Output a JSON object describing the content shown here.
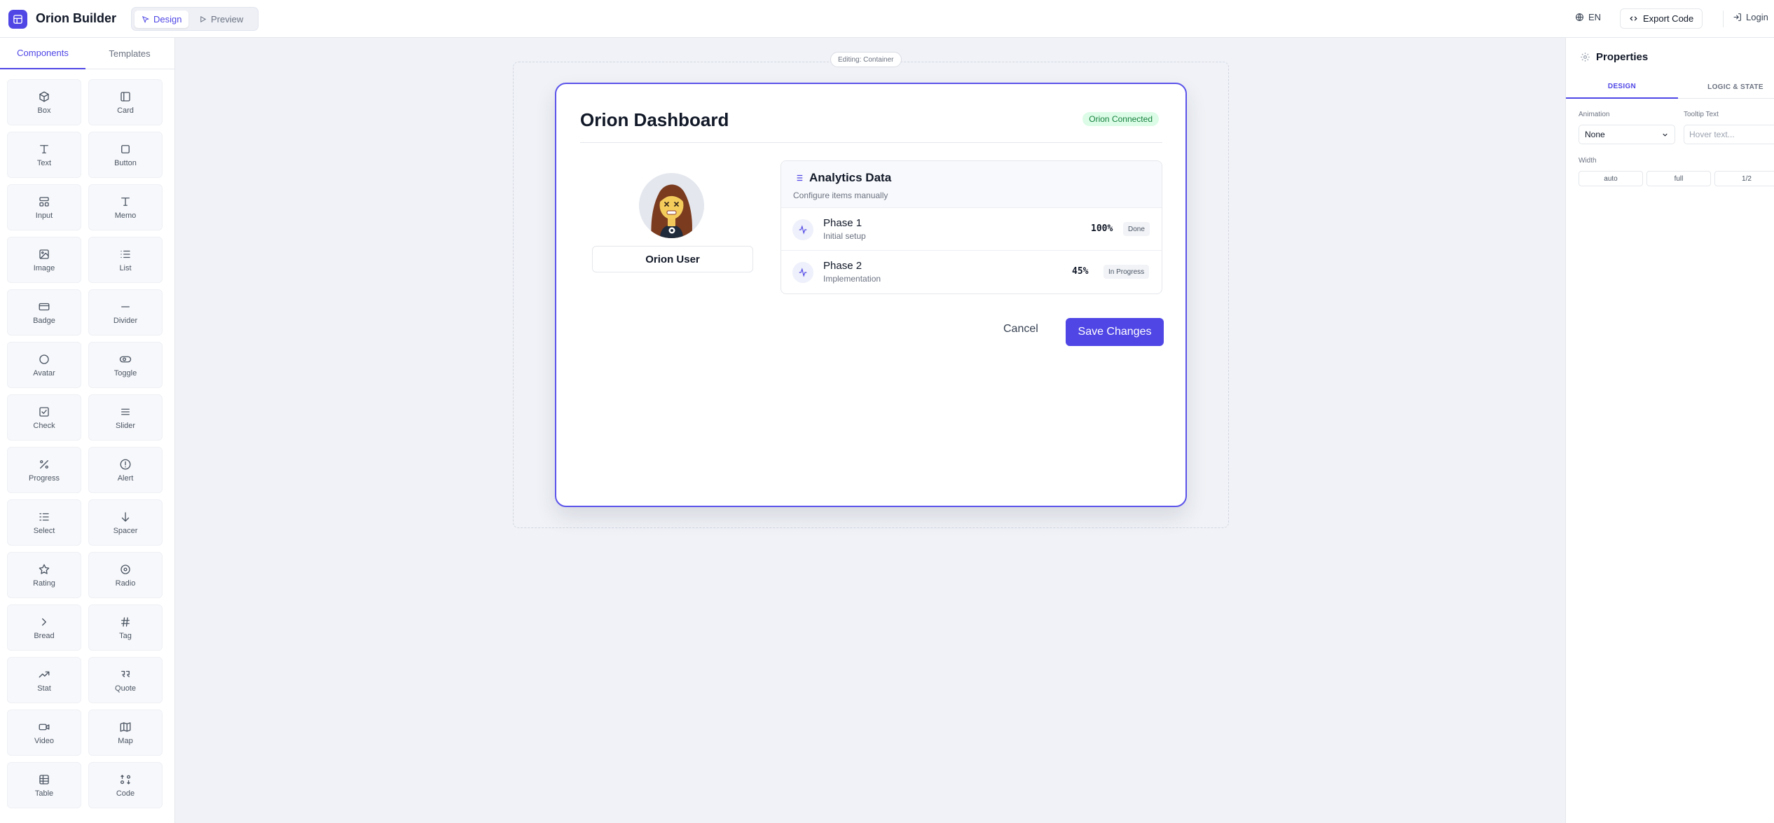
{
  "app": {
    "title": "Orion Builder"
  },
  "header": {
    "modes": [
      {
        "label": "Design"
      },
      {
        "label": "Preview"
      }
    ],
    "language": "EN",
    "export_label": "Export Code",
    "login_label": "Login"
  },
  "sidebar": {
    "tabs": [
      {
        "label": "Components"
      },
      {
        "label": "Templates"
      }
    ],
    "components": [
      {
        "label": "Box",
        "icon": "box-icon"
      },
      {
        "label": "Card",
        "icon": "card-icon"
      },
      {
        "label": "Text",
        "icon": "text-icon"
      },
      {
        "label": "Button",
        "icon": "button-icon"
      },
      {
        "label": "Input",
        "icon": "input-icon"
      },
      {
        "label": "Memo",
        "icon": "memo-icon"
      },
      {
        "label": "Image",
        "icon": "image-icon"
      },
      {
        "label": "List",
        "icon": "list-icon"
      },
      {
        "label": "Badge",
        "icon": "badge-icon"
      },
      {
        "label": "Divider",
        "icon": "divider-icon"
      },
      {
        "label": "Avatar",
        "icon": "avatar-icon"
      },
      {
        "label": "Toggle",
        "icon": "toggle-icon"
      },
      {
        "label": "Check",
        "icon": "check-icon"
      },
      {
        "label": "Slider",
        "icon": "slider-icon"
      },
      {
        "label": "Progress",
        "icon": "percent-icon"
      },
      {
        "label": "Alert",
        "icon": "alert-icon"
      },
      {
        "label": "Select",
        "icon": "select-icon"
      },
      {
        "label": "Spacer",
        "icon": "arrow-down-icon"
      },
      {
        "label": "Rating",
        "icon": "star-icon"
      },
      {
        "label": "Radio",
        "icon": "radio-icon"
      },
      {
        "label": "Bread",
        "icon": "chevron-right-icon"
      },
      {
        "label": "Tag",
        "icon": "hash-icon"
      },
      {
        "label": "Stat",
        "icon": "trending-up-icon"
      },
      {
        "label": "Quote",
        "icon": "quote-icon"
      },
      {
        "label": "Video",
        "icon": "video-icon"
      },
      {
        "label": "Map",
        "icon": "map-icon"
      },
      {
        "label": "Table",
        "icon": "table-icon"
      },
      {
        "label": "Code",
        "icon": "code-icon"
      }
    ]
  },
  "canvas": {
    "editing_label": "Editing: Container",
    "card": {
      "title": "Orion Dashboard",
      "badge": "Orion Connected",
      "user_name": "Orion User",
      "analytics": {
        "title": "Analytics Data",
        "subtitle": "Configure items manually",
        "phases": [
          {
            "name": "Phase 1",
            "desc": "Initial setup",
            "progress": "100%",
            "status": "Done"
          },
          {
            "name": "Phase 2",
            "desc": "Implementation",
            "progress": "45%",
            "status": "In Progress"
          }
        ]
      },
      "cancel_label": "Cancel",
      "save_label": "Save Changes"
    }
  },
  "properties": {
    "title": "Properties",
    "tabs": [
      {
        "label": "DESIGN"
      },
      {
        "label": "LOGIC & STATE"
      }
    ],
    "animation_label": "Animation",
    "animation_value": "None",
    "tooltip_label": "Tooltip Text",
    "tooltip_placeholder": "Hover text...",
    "width_label": "Width",
    "width_options": [
      "auto",
      "full",
      "1/2"
    ]
  },
  "colors": {
    "accent": "#4f46e5",
    "badge_bg": "#dcfce7",
    "badge_text": "#15803d",
    "canvas_bg": "#f0f2f7"
  }
}
